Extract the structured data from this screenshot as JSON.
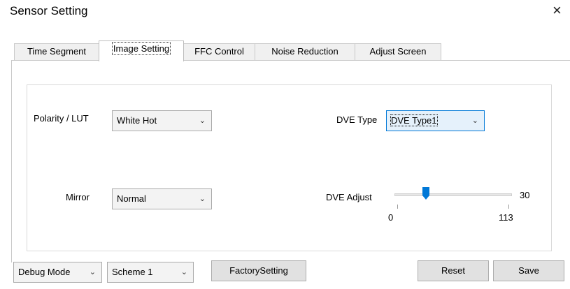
{
  "window": {
    "title": "Sensor Setting",
    "close_icon": "×"
  },
  "tabs": [
    {
      "label": "Time Segment"
    },
    {
      "label": "Image Setting"
    },
    {
      "label": "FFC Control"
    },
    {
      "label": "Noise Reduction"
    },
    {
      "label": "Adjust Screen"
    }
  ],
  "active_tab": "Image Setting",
  "polarity": {
    "label": "Polarity / LUT",
    "value": "White Hot"
  },
  "mirror": {
    "label": "Mirror",
    "value": "Normal"
  },
  "dve_type": {
    "label": "DVE Type",
    "value": "DVE Type1"
  },
  "dve_adjust": {
    "label": "DVE Adjust",
    "value": "30",
    "min": "0",
    "max": "113"
  },
  "bottom": {
    "debug_mode": "Debug Modе",
    "scheme": "Scheme 1",
    "factory_setting": "FactorySetting",
    "reset": "Reset",
    "save": "Save"
  },
  "colors": {
    "slider_thumb": "#0078d7"
  },
  "icons": {
    "dropdown": "chevron-down-icon",
    "close": "close-icon"
  }
}
